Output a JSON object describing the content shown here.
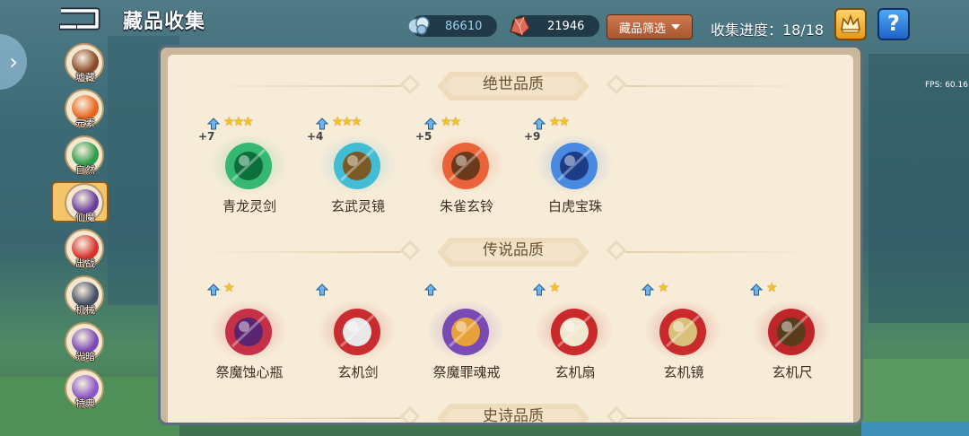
{
  "header": {
    "title": "藏品收集",
    "currency_blue": "86610",
    "currency_red": "21946",
    "filter_label": "藏品筛选",
    "progress_label": "收集进度：18/18",
    "help_label": "?",
    "fps": "FPS: 60.16"
  },
  "categories": [
    {
      "label": "墟藏",
      "color": "#8a4a2a"
    },
    {
      "label": "元素",
      "color": "#e9661f"
    },
    {
      "label": "自然",
      "color": "#2f9b4a"
    },
    {
      "label": "仙魔",
      "color": "#6a3f9c"
    },
    {
      "label": "出战",
      "color": "#d6332f"
    },
    {
      "label": "机械",
      "color": "#444e63"
    },
    {
      "label": "光暗",
      "color": "#7c4ab5"
    },
    {
      "label": "特典",
      "color": "#8b58c6"
    }
  ],
  "selected_category": "仙魔",
  "sections": [
    {
      "title": "绝世品质",
      "items": [
        {
          "name": "青龙灵剑",
          "level": "+7",
          "stars": "★★★",
          "color": "#23b369",
          "accent": "#0d6f3c"
        },
        {
          "name": "玄武灵镜",
          "level": "+4",
          "stars": "★★★",
          "color": "#32b8d4",
          "accent": "#7a5a25"
        },
        {
          "name": "朱雀玄铃",
          "level": "+5",
          "stars": "★★",
          "color": "#e9572a",
          "accent": "#6b3a1c"
        },
        {
          "name": "白虎宝珠",
          "level": "+9",
          "stars": "★★",
          "color": "#3a7fe0",
          "accent": "#1c3d86"
        }
      ]
    },
    {
      "title": "传说品质",
      "items": [
        {
          "name": "祭魔蚀心瓶",
          "level": "",
          "stars": "★",
          "color": "#c11f3a",
          "accent": "#5a2470"
        },
        {
          "name": "玄机剑",
          "level": "",
          "stars": "",
          "color": "#c41b1f",
          "accent": "#e8e8e8"
        },
        {
          "name": "祭魔罪魂戒",
          "level": "",
          "stars": "",
          "color": "#6d3bb0",
          "accent": "#e8a03a"
        },
        {
          "name": "玄机扇",
          "level": "",
          "stars": "★",
          "color": "#c5171c",
          "accent": "#f2e7cf"
        },
        {
          "name": "玄机镜",
          "level": "",
          "stars": "★",
          "color": "#c5171c",
          "accent": "#d8c07a"
        },
        {
          "name": "玄机尺",
          "level": "",
          "stars": "★",
          "color": "#b8141a",
          "accent": "#5a3b1c"
        }
      ]
    },
    {
      "title": "史诗品质",
      "items": []
    }
  ]
}
